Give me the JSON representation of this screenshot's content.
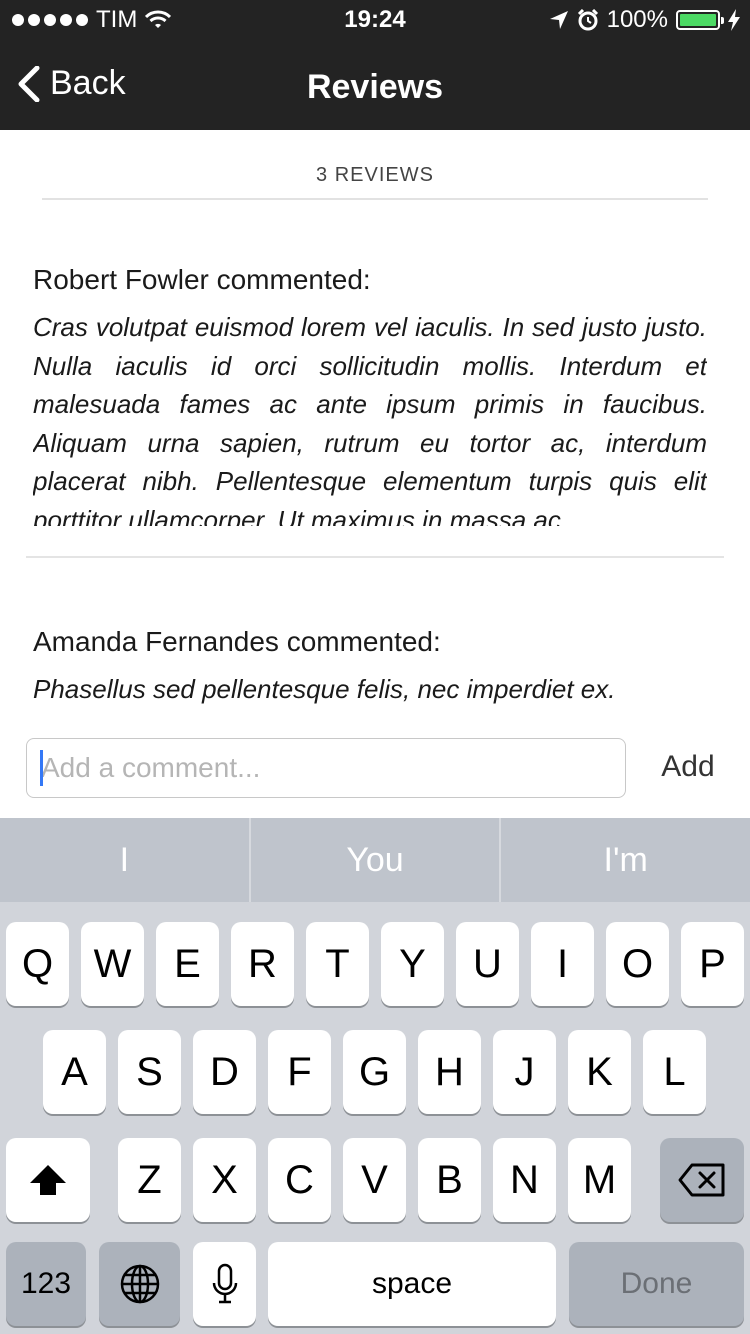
{
  "status_bar": {
    "carrier": "TIM",
    "time": "19:24",
    "battery": "100%",
    "battery_level": 1.0
  },
  "nav": {
    "back_label": "Back",
    "title": "Reviews"
  },
  "reviews_count": "3 REVIEWS",
  "reviews": [
    {
      "author": "Robert Fowler commented:",
      "text": "Cras volutpat euismod lorem vel iaculis. In sed justo justo. Nulla iaculis id orci sollicitudin mollis. Interdum et malesuada fames ac ante ipsum primis in faucibus. Aliquam urna sapien, rutrum eu tortor ac, interdum placerat nibh. Pellentesque elementum turpis quis elit porttitor ullamcorper. Ut maximus in massa ac"
    },
    {
      "author": "Amanda Fernandes commented:",
      "text": "Phasellus sed pellentesque felis, nec imperdiet ex."
    }
  ],
  "comment": {
    "placeholder": "Add a comment...",
    "value": "",
    "add_label": "Add"
  },
  "keyboard": {
    "suggestions": [
      "I",
      "You",
      "I'm"
    ],
    "row1": [
      "Q",
      "W",
      "E",
      "R",
      "T",
      "Y",
      "U",
      "I",
      "O",
      "P"
    ],
    "row2": [
      "A",
      "S",
      "D",
      "F",
      "G",
      "H",
      "J",
      "K",
      "L"
    ],
    "row3": [
      "Z",
      "X",
      "C",
      "V",
      "B",
      "N",
      "M"
    ],
    "numbers_label": "123",
    "space_label": "space",
    "done_label": "Done"
  },
  "colors": {
    "nav_background": "#232323",
    "battery_fill": "#4cd964",
    "keyboard_background": "#d1d4da",
    "caret": "#3478f6"
  },
  "icons": [
    "signal-dots-icon",
    "wifi-icon",
    "location-arrow-icon",
    "alarm-icon",
    "battery-icon",
    "charging-bolt-icon",
    "back-chevron-icon",
    "shift-icon",
    "backspace-icon",
    "globe-icon",
    "microphone-icon"
  ]
}
